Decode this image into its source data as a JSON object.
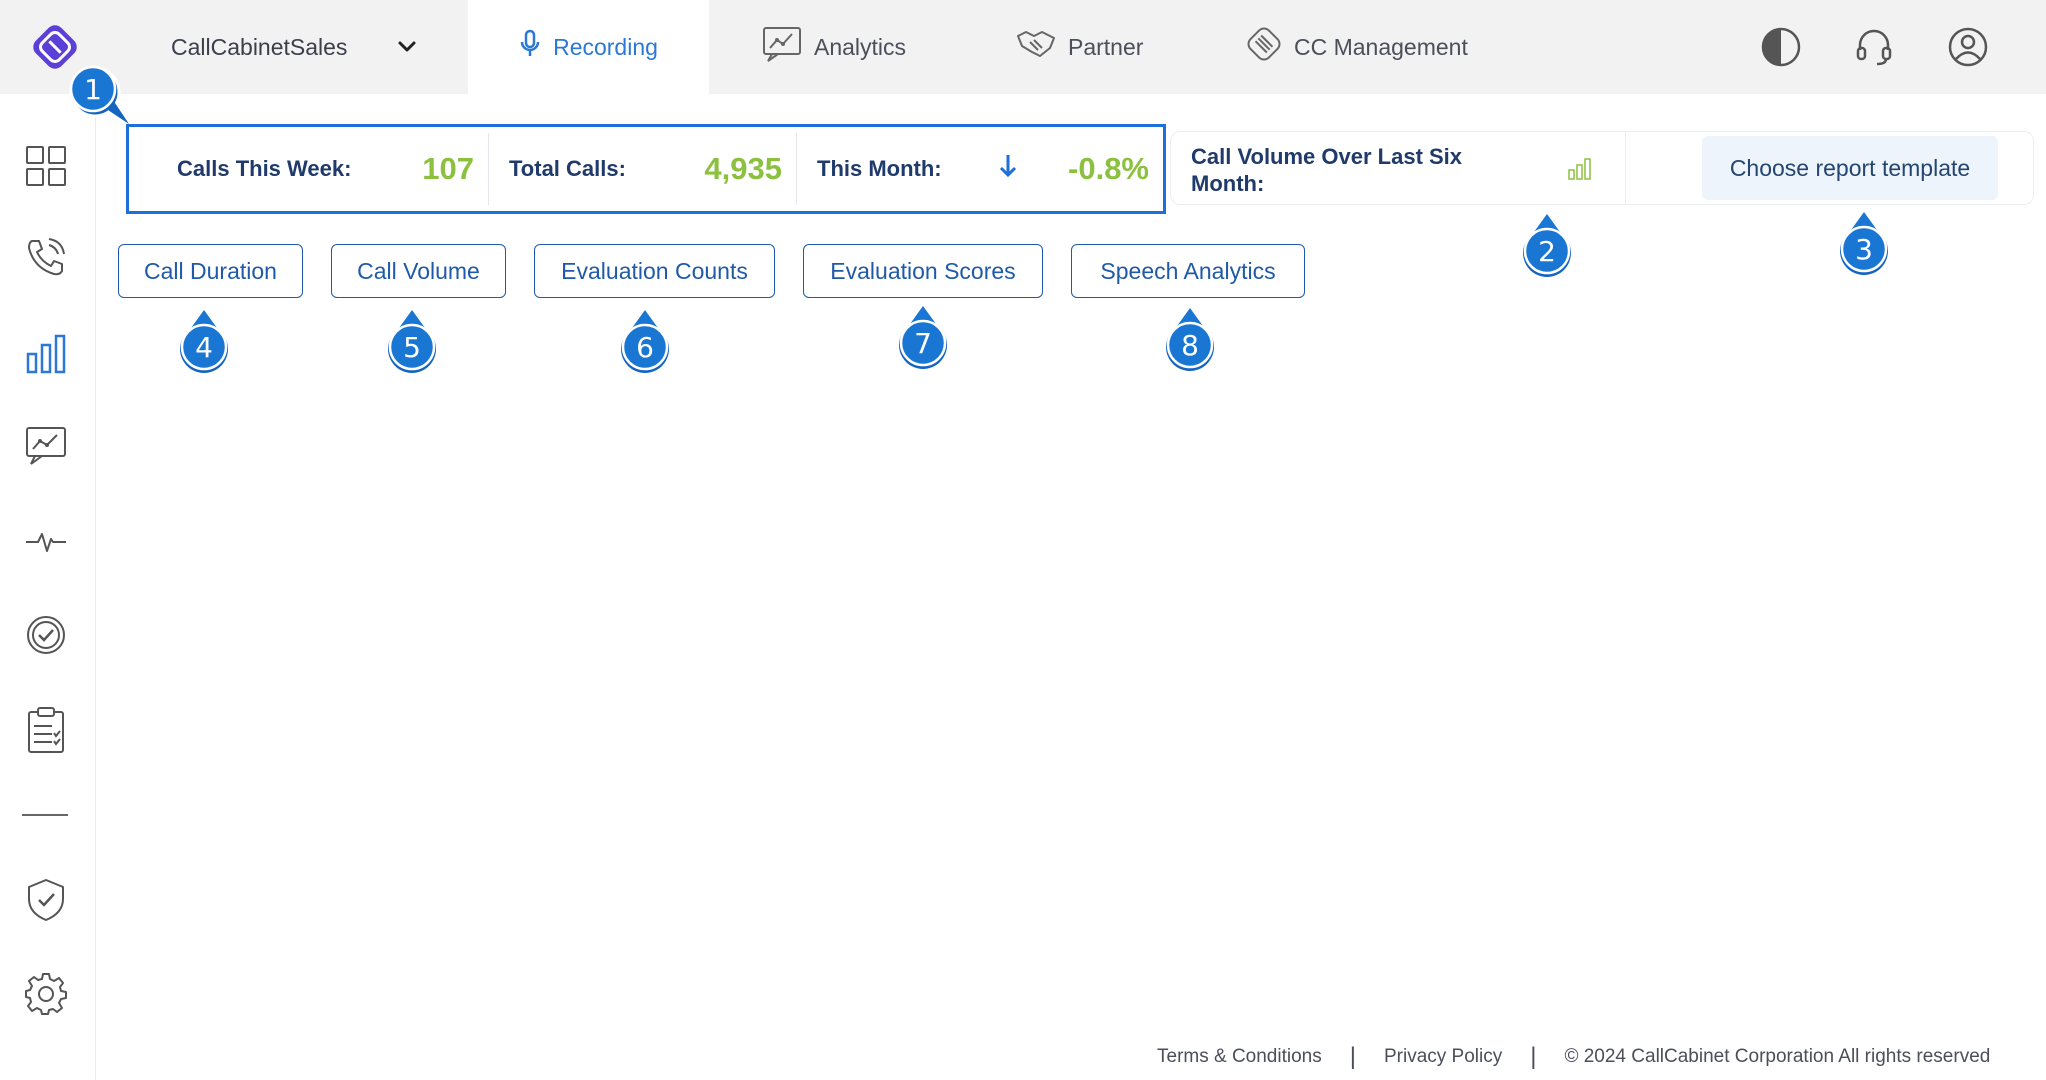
{
  "header": {
    "org_name": "CallCabinetSales",
    "tabs": [
      {
        "label": "Recording",
        "icon": "microphone-icon",
        "active": true
      },
      {
        "label": "Analytics",
        "icon": "analytics-chart-icon",
        "active": false
      },
      {
        "label": "Partner",
        "icon": "handshake-icon",
        "active": false
      },
      {
        "label": "CC Management",
        "icon": "cc-management-icon",
        "active": false
      }
    ],
    "right_icons": [
      "contrast-icon",
      "headset-icon",
      "user-icon"
    ]
  },
  "sidebar": {
    "items": [
      "dashboard-grid-icon",
      "phone-call-icon",
      "bar-chart-icon",
      "analytics-chart-icon",
      "pulse-icon",
      "check-circle-icon",
      "checklist-clipboard-icon",
      "divider",
      "shield-check-icon",
      "settings-gear-icon"
    ]
  },
  "stats": [
    {
      "label": "Calls This Week:",
      "value": "107"
    },
    {
      "label": "Total Calls:",
      "value": "4,935"
    },
    {
      "label": "This Month:",
      "value": "-0.8%",
      "trend_icon": "arrow-down-icon"
    }
  ],
  "volume_panel": {
    "label": "Call Volume Over Last Six Month:",
    "report_button": "Choose report template"
  },
  "report_buttons": [
    "Call Duration",
    "Call Volume",
    "Evaluation Counts",
    "Evaluation Scores",
    "Speech Analytics"
  ],
  "callouts": [
    "1",
    "2",
    "3",
    "4",
    "5",
    "6",
    "7",
    "8"
  ],
  "footer": {
    "terms": "Terms & Conditions",
    "privacy": "Privacy Policy",
    "copyright": "© 2024 CallCabinet Corporation All rights reserved",
    "separator": "|"
  },
  "colors": {
    "accent_blue": "#1d6fdc",
    "value_green": "#8cc13f",
    "callout_blue": "#1976d2",
    "topbar_bg": "#f2f2f2"
  }
}
